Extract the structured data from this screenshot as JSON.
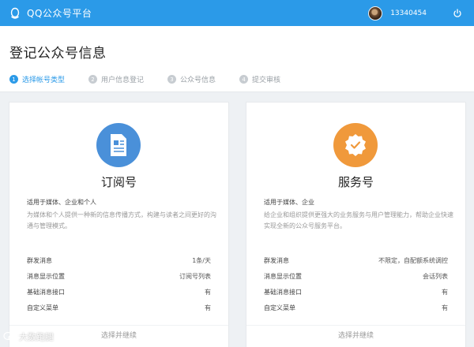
{
  "topbar": {
    "brand": "QQ公众号平台",
    "user_id": "13340454",
    "colors": {
      "bar": "#2b9ae8"
    },
    "icons": {
      "logo": "qq-penguin-icon",
      "power": "power-icon"
    }
  },
  "page": {
    "title": "登记公众号信息",
    "steps": [
      {
        "num": "1",
        "label": "选择帐号类型",
        "active": true
      },
      {
        "num": "2",
        "label": "用户信息登记",
        "active": false
      },
      {
        "num": "3",
        "label": "公众号信息",
        "active": false
      },
      {
        "num": "4",
        "label": "提交审核",
        "active": false
      }
    ]
  },
  "cards": [
    {
      "icon": "document-icon",
      "icon_color": "#4a90d9",
      "title": "订阅号",
      "subtitle": "适用于媒体、企业和个人",
      "description": "为媒体和个人提供一种新的信息传播方式，构建与读者之间更好的沟通与管理模式。",
      "features": [
        {
          "name": "群发消息",
          "value": "1条/天"
        },
        {
          "name": "消息显示位置",
          "value": "订阅号列表"
        },
        {
          "name": "基础消息接口",
          "value": "有"
        },
        {
          "name": "自定义菜单",
          "value": "有"
        }
      ],
      "button": "选择并继续"
    },
    {
      "icon": "badge-check-icon",
      "icon_color": "#f0993b",
      "title": "服务号",
      "subtitle": "适用于媒体、企业",
      "description": "给企业和组织提供更强大的业务服务与用户管理能力，帮助企业快速实现全新的公众号服务平台。",
      "features": [
        {
          "name": "群发消息",
          "value": "不限定，自配额系统调控"
        },
        {
          "name": "消息显示位置",
          "value": "会话列表"
        },
        {
          "name": "基础消息接口",
          "value": "有"
        },
        {
          "name": "自定义菜单",
          "value": "有"
        }
      ],
      "button": "选择并继续"
    }
  ],
  "watermark": {
    "text": "大数跑腿"
  }
}
